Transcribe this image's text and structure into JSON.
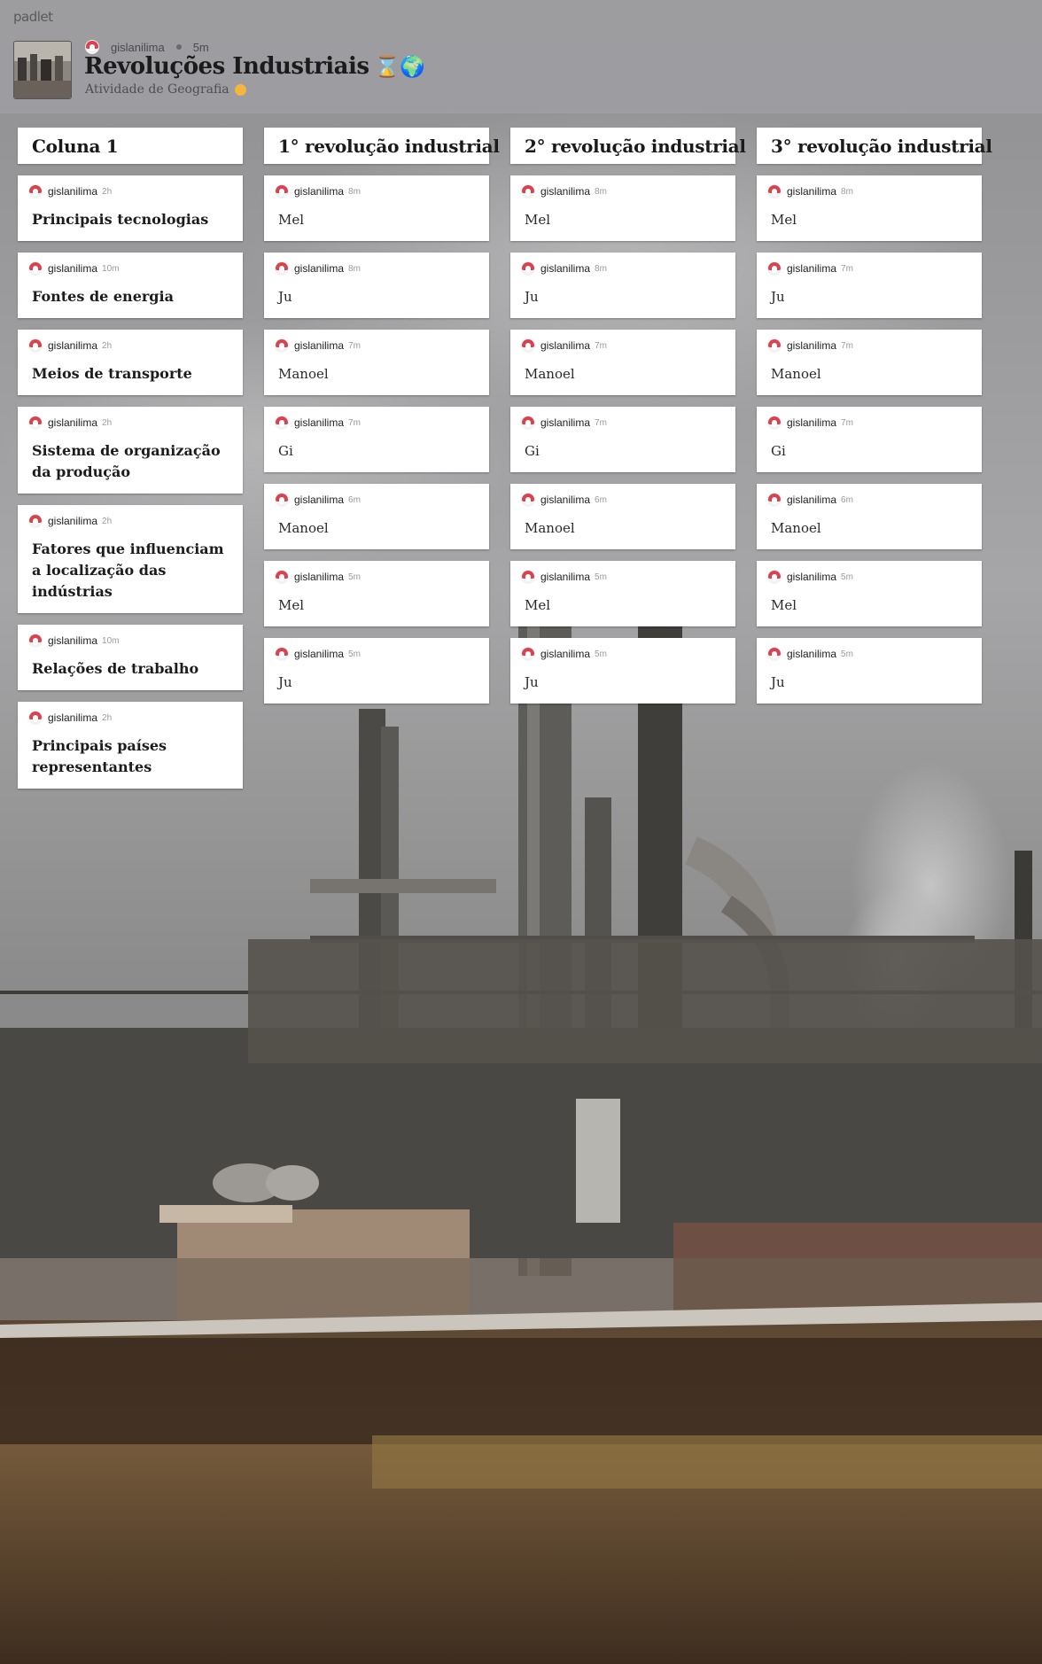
{
  "app": {
    "brand": "padlet"
  },
  "board": {
    "author": "gislanilima",
    "updated": "5m",
    "title": "Revoluções Industriais",
    "title_emojis": "⌛🌍",
    "subtitle": "Atividade de Geografia"
  },
  "columns": [
    {
      "title": "Coluna 1",
      "posts": [
        {
          "author": "gislanilima",
          "time": "2h",
          "title": "Principais tecnologias"
        },
        {
          "author": "gislanilima",
          "time": "10m",
          "title": "Fontes de energia"
        },
        {
          "author": "gislanilima",
          "time": "2h",
          "title": "Meios de transporte"
        },
        {
          "author": "gislanilima",
          "time": "2h",
          "title": "Sistema de organização da produção"
        },
        {
          "author": "gislanilima",
          "time": "2h",
          "title": "Fatores que influenciam a localização das indústrias"
        },
        {
          "author": "gislanilima",
          "time": "10m",
          "title": "Relações de trabalho"
        },
        {
          "author": "gislanilima",
          "time": "2h",
          "title": "Principais países representantes"
        }
      ]
    },
    {
      "title": "1° revolução industrial",
      "posts": [
        {
          "author": "gislanilima",
          "time": "8m",
          "body": "Mel"
        },
        {
          "author": "gislanilima",
          "time": "8m",
          "body": "Ju"
        },
        {
          "author": "gislanilima",
          "time": "7m",
          "body": "Manoel"
        },
        {
          "author": "gislanilima",
          "time": "7m",
          "body": "Gi"
        },
        {
          "author": "gislanilima",
          "time": "6m",
          "body": "Manoel"
        },
        {
          "author": "gislanilima",
          "time": "5m",
          "body": "Mel"
        },
        {
          "author": "gislanilima",
          "time": "5m",
          "body": "Ju"
        }
      ]
    },
    {
      "title": "2° revolução industrial",
      "posts": [
        {
          "author": "gislanilima",
          "time": "8m",
          "body": "Mel"
        },
        {
          "author": "gislanilima",
          "time": "8m",
          "body": "Ju"
        },
        {
          "author": "gislanilima",
          "time": "7m",
          "body": "Manoel"
        },
        {
          "author": "gislanilima",
          "time": "7m",
          "body": "Gi"
        },
        {
          "author": "gislanilima",
          "time": "6m",
          "body": "Manoel"
        },
        {
          "author": "gislanilima",
          "time": "5m",
          "body": "Mel"
        },
        {
          "author": "gislanilima",
          "time": "5m",
          "body": "Ju"
        }
      ]
    },
    {
      "title": "3° revolução industrial",
      "posts": [
        {
          "author": "gislanilima",
          "time": "8m",
          "body": "Mel"
        },
        {
          "author": "gislanilima",
          "time": "7m",
          "body": "Ju"
        },
        {
          "author": "gislanilima",
          "time": "7m",
          "body": "Manoel"
        },
        {
          "author": "gislanilima",
          "time": "7m",
          "body": "Gi"
        },
        {
          "author": "gislanilima",
          "time": "6m",
          "body": "Manoel"
        },
        {
          "author": "gislanilima",
          "time": "5m",
          "body": "Mel"
        },
        {
          "author": "gislanilima",
          "time": "5m",
          "body": "Ju"
        }
      ]
    }
  ]
}
